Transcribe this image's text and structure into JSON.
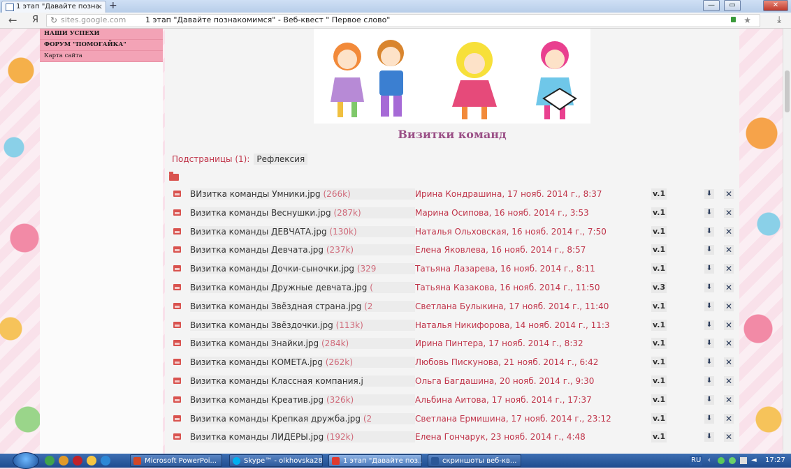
{
  "browser": {
    "tab_title": "1 этап \"Давайте позна",
    "new_tab_label": "+",
    "yandex_label": "Я",
    "host": "sites.google.com",
    "page_title": "1 этап \"Давайте познакомимся\" - Веб-квест \" Первое слово\""
  },
  "sidebar": {
    "links": [
      "НАШИ УСПЕХИ",
      "ФОРУМ \"ПОМОГАЙКА\"",
      "Карта сайта"
    ]
  },
  "main": {
    "heading": "Визитки команд",
    "subpages_label": "Подстраницы (1):",
    "subpage_link": "Рефлексия",
    "files": [
      {
        "name": "ВИзитка команды Умники.jpg",
        "size": "(266k)",
        "author": "Ирина Кондрашина",
        "date": "17 нояб. 2014 г., 8:37",
        "version": "v.1"
      },
      {
        "name": "Визитка команды Веснушки.jpg",
        "size": "(287k)",
        "author": "Марина Осипова",
        "date": "16 нояб. 2014 г., 3:53",
        "version": "v.1"
      },
      {
        "name": "Визитка команды ДЕВЧАТА.jpg",
        "size": "(130k)",
        "author": "Наталья Ольховская",
        "date": "16 нояб. 2014 г., 7:50",
        "version": "v.1"
      },
      {
        "name": "Визитка команды Девчата.jpg",
        "size": "(237k)",
        "author": "Елена Яковлева",
        "date": "16 нояб. 2014 г., 8:57",
        "version": "v.1"
      },
      {
        "name": "Визитка команды Дочки-сыночки.jpg",
        "size": "(329",
        "author": "Татьяна Лазарева",
        "date": "16 нояб. 2014 г., 8:11",
        "version": "v.1"
      },
      {
        "name": "Визитка команды Дружные девчата.jpg",
        "size": "(",
        "author": "Татьяна Казакова",
        "date": "16 нояб. 2014 г., 11:50",
        "version": "v.3"
      },
      {
        "name": "Визитка команды Звёздная страна.jpg",
        "size": "(2",
        "author": "Светлана Булыкина",
        "date": "17 нояб. 2014 г., 11:40",
        "version": "v.1"
      },
      {
        "name": "Визитка команды Звёздочки.jpg",
        "size": "(113k)",
        "author": "Наталья Никифорова",
        "date": "14 нояб. 2014 г., 11:3",
        "version": "v.1"
      },
      {
        "name": "Визитка команды Знайки.jpg",
        "size": "(284k)",
        "author": "Ирина Пинтера",
        "date": "17 нояб. 2014 г., 8:32",
        "version": "v.1"
      },
      {
        "name": "Визитка команды КОМЕТА.jpg",
        "size": "(262k)",
        "author": "Любовь Пискунова",
        "date": "21 нояб. 2014 г., 6:42",
        "version": "v.1"
      },
      {
        "name": "Визитка команды Классная компания.j",
        "size": "",
        "author": "Ольга Багдашина",
        "date": "20 нояб. 2014 г., 9:30",
        "version": "v.1"
      },
      {
        "name": "Визитка команды Креатив.jpg",
        "size": "(326k)",
        "author": "Альбина Аитова",
        "date": "17 нояб. 2014 г., 17:37",
        "version": "v.1"
      },
      {
        "name": "Визитка команды Крепкая дружба.jpg",
        "size": "(2",
        "author": "Светлана Ермишина",
        "date": "17 нояб. 2014 г., 23:12",
        "version": "v.1"
      },
      {
        "name": "Визитка команды ЛИДЕРЫ.jpg",
        "size": "(192k)",
        "author": "Елена Гончарук",
        "date": "23 нояб. 2014 г., 4:48",
        "version": "v.1"
      }
    ]
  },
  "taskbar": {
    "items": [
      "Microsoft PowerPoi...",
      "Skype™ - olkhovska28",
      "1 этап \"Давайте поз...",
      "скриншоты веб-кв..."
    ],
    "lang": "RU",
    "clock": "17:27"
  }
}
